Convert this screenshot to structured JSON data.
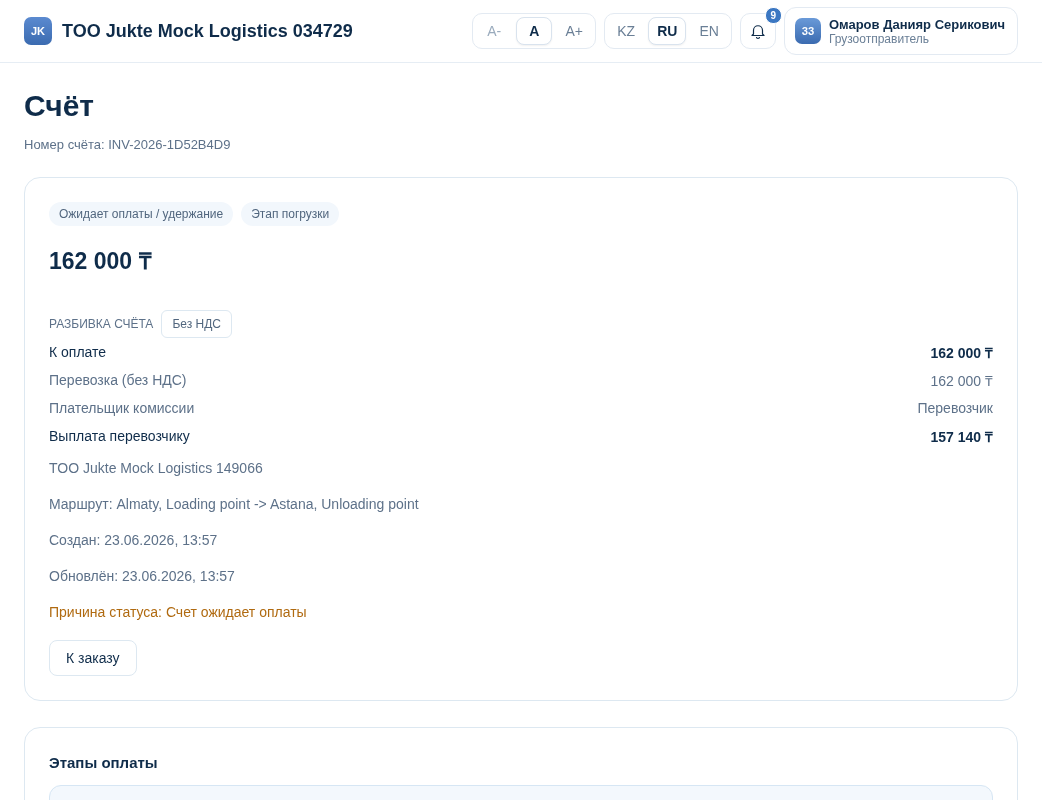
{
  "header": {
    "logo": "JK",
    "company": "TOO Jukte Mock Logistics 034729",
    "font_sizes": [
      {
        "label": "A-",
        "selected": false,
        "disabled": true
      },
      {
        "label": "A",
        "selected": true,
        "disabled": false
      },
      {
        "label": "A+",
        "selected": false,
        "disabled": false
      }
    ],
    "languages": [
      {
        "label": "KZ",
        "selected": false
      },
      {
        "label": "RU",
        "selected": true
      },
      {
        "label": "EN",
        "selected": false
      }
    ],
    "notifications": "9",
    "user": {
      "avatar": "ЗЗ",
      "name": "Омаров Данияр Серикович",
      "role": "Грузоотправитель"
    }
  },
  "page": {
    "title": "Счёт",
    "subtitle": "Номер счёта: INV-2026-1D52B4D9"
  },
  "invoice": {
    "tags": [
      "Ожидает оплаты / удержание",
      "Этап погрузки"
    ],
    "amount": "162 000 ₸",
    "breakdown_label": "РАЗБИВКА СЧЁТА",
    "vat_badge": "Без НДС",
    "rows": [
      {
        "label": "К оплате",
        "value": "162 000 ₸",
        "emphasis": true
      },
      {
        "label": "Перевозка (без НДС)",
        "value": "162 000 ₸",
        "emphasis": false
      },
      {
        "label": "Плательщик комиссии",
        "value": "Перевозчик",
        "emphasis": false
      },
      {
        "label": "Выплата перевозчику",
        "value": "157 140 ₸",
        "emphasis": true
      }
    ],
    "details": [
      {
        "text": "TOO Jukte Mock Logistics 149066",
        "kind": "info"
      },
      {
        "text": "Маршрут: Almaty, Loading point -> Astana, Unloading point",
        "kind": "info"
      },
      {
        "text": "Создан: 23.06.2026, 13:57",
        "kind": "info"
      },
      {
        "text": "Обновлён: 23.06.2026, 13:57",
        "kind": "info"
      },
      {
        "text": "Причина статуса: Счет ожидает оплаты",
        "kind": "warning"
      }
    ],
    "button": "К заказу"
  },
  "payment_stages": {
    "title": "Этапы оплаты"
  }
}
